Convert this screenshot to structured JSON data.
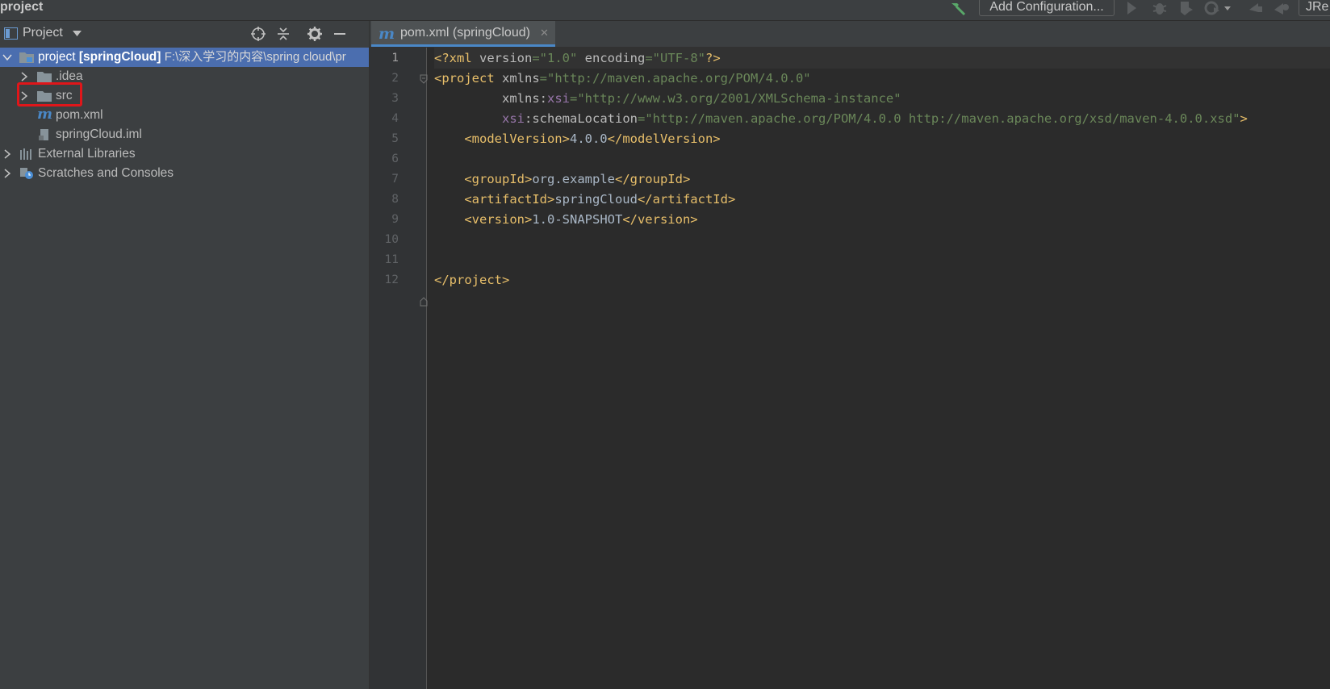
{
  "window": {
    "title": "project"
  },
  "toolbar": {
    "add_configuration_label": "Add Configuration...",
    "jre_label": "JRe"
  },
  "project_panel": {
    "header_label": "Project",
    "tree": [
      {
        "label": "project",
        "module": "[springCloud]",
        "path": "F:\\深入学习的内容\\spring cloud\\pr",
        "icon": "module-folder-icon",
        "expanded": true,
        "selected": true
      },
      {
        "label": ".idea",
        "icon": "folder-icon",
        "expanded": false
      },
      {
        "label": "src",
        "icon": "folder-icon",
        "expanded": false,
        "highlighted": true
      },
      {
        "label": "pom.xml",
        "icon": "maven-file-icon"
      },
      {
        "label": "springCloud.iml",
        "icon": "iml-file-icon"
      },
      {
        "label": "External Libraries",
        "icon": "libraries-icon",
        "expanded": false
      },
      {
        "label": "Scratches and Consoles",
        "icon": "scratches-icon",
        "expanded": false
      }
    ]
  },
  "editor": {
    "active_tab": {
      "label": "pom.xml (springCloud)",
      "icon": "maven-file-icon"
    },
    "line_numbers": [
      "1",
      "2",
      "3",
      "4",
      "5",
      "6",
      "7",
      "8",
      "9",
      "10",
      "11",
      "12"
    ],
    "lines": [
      [
        {
          "t": "<?xml ",
          "c": "tg"
        },
        {
          "t": "version",
          "c": "at"
        },
        {
          "t": "=\"1.0\"",
          "c": "av"
        },
        {
          "t": " encoding",
          "c": "at"
        },
        {
          "t": "=\"UTF-8\"",
          "c": "av"
        },
        {
          "t": "?>",
          "c": "tg"
        }
      ],
      [
        {
          "t": "<project ",
          "c": "tg"
        },
        {
          "t": "xmlns",
          "c": "at"
        },
        {
          "t": "=\"http://maven.apache.org/POM/4.0.0\"",
          "c": "av"
        }
      ],
      [
        {
          "t": "         xmlns:",
          "c": "at"
        },
        {
          "t": "xsi",
          "c": "ns"
        },
        {
          "t": "=\"http://www.w3.org/2001/XMLSchema-instance\"",
          "c": "av"
        }
      ],
      [
        {
          "t": "         ",
          "c": "at"
        },
        {
          "t": "xsi",
          "c": "ns"
        },
        {
          "t": ":schemaLocation",
          "c": "at"
        },
        {
          "t": "=\"http://maven.apache.org/POM/4.0.0 http://maven.apache.org/xsd/maven-4.0.0.xsd\"",
          "c": "av"
        },
        {
          "t": ">",
          "c": "tg"
        }
      ],
      [
        {
          "t": "    <modelVersion>",
          "c": "tg"
        },
        {
          "t": "4.0.0",
          "c": "tx"
        },
        {
          "t": "</modelVersion>",
          "c": "tg"
        }
      ],
      [],
      [
        {
          "t": "    <groupId>",
          "c": "tg"
        },
        {
          "t": "org.example",
          "c": "tx"
        },
        {
          "t": "</groupId>",
          "c": "tg"
        }
      ],
      [
        {
          "t": "    <artifactId>",
          "c": "tg"
        },
        {
          "t": "springCloud",
          "c": "tx"
        },
        {
          "t": "</artifactId>",
          "c": "tg"
        }
      ],
      [
        {
          "t": "    <version>",
          "c": "tg"
        },
        {
          "t": "1.0-SNAPSHOT",
          "c": "tx"
        },
        {
          "t": "</version>",
          "c": "tg"
        }
      ],
      [],
      [],
      [
        {
          "t": "</project>",
          "c": "tg"
        }
      ]
    ]
  },
  "colors": {
    "background": "#2b2b2b",
    "panel": "#3c3f41",
    "selection": "#4b6eaf",
    "highlight_box": "#e0161a",
    "xml_tag": "#e8bf6a",
    "xml_value": "#6a8759",
    "namespace": "#9876aa"
  }
}
